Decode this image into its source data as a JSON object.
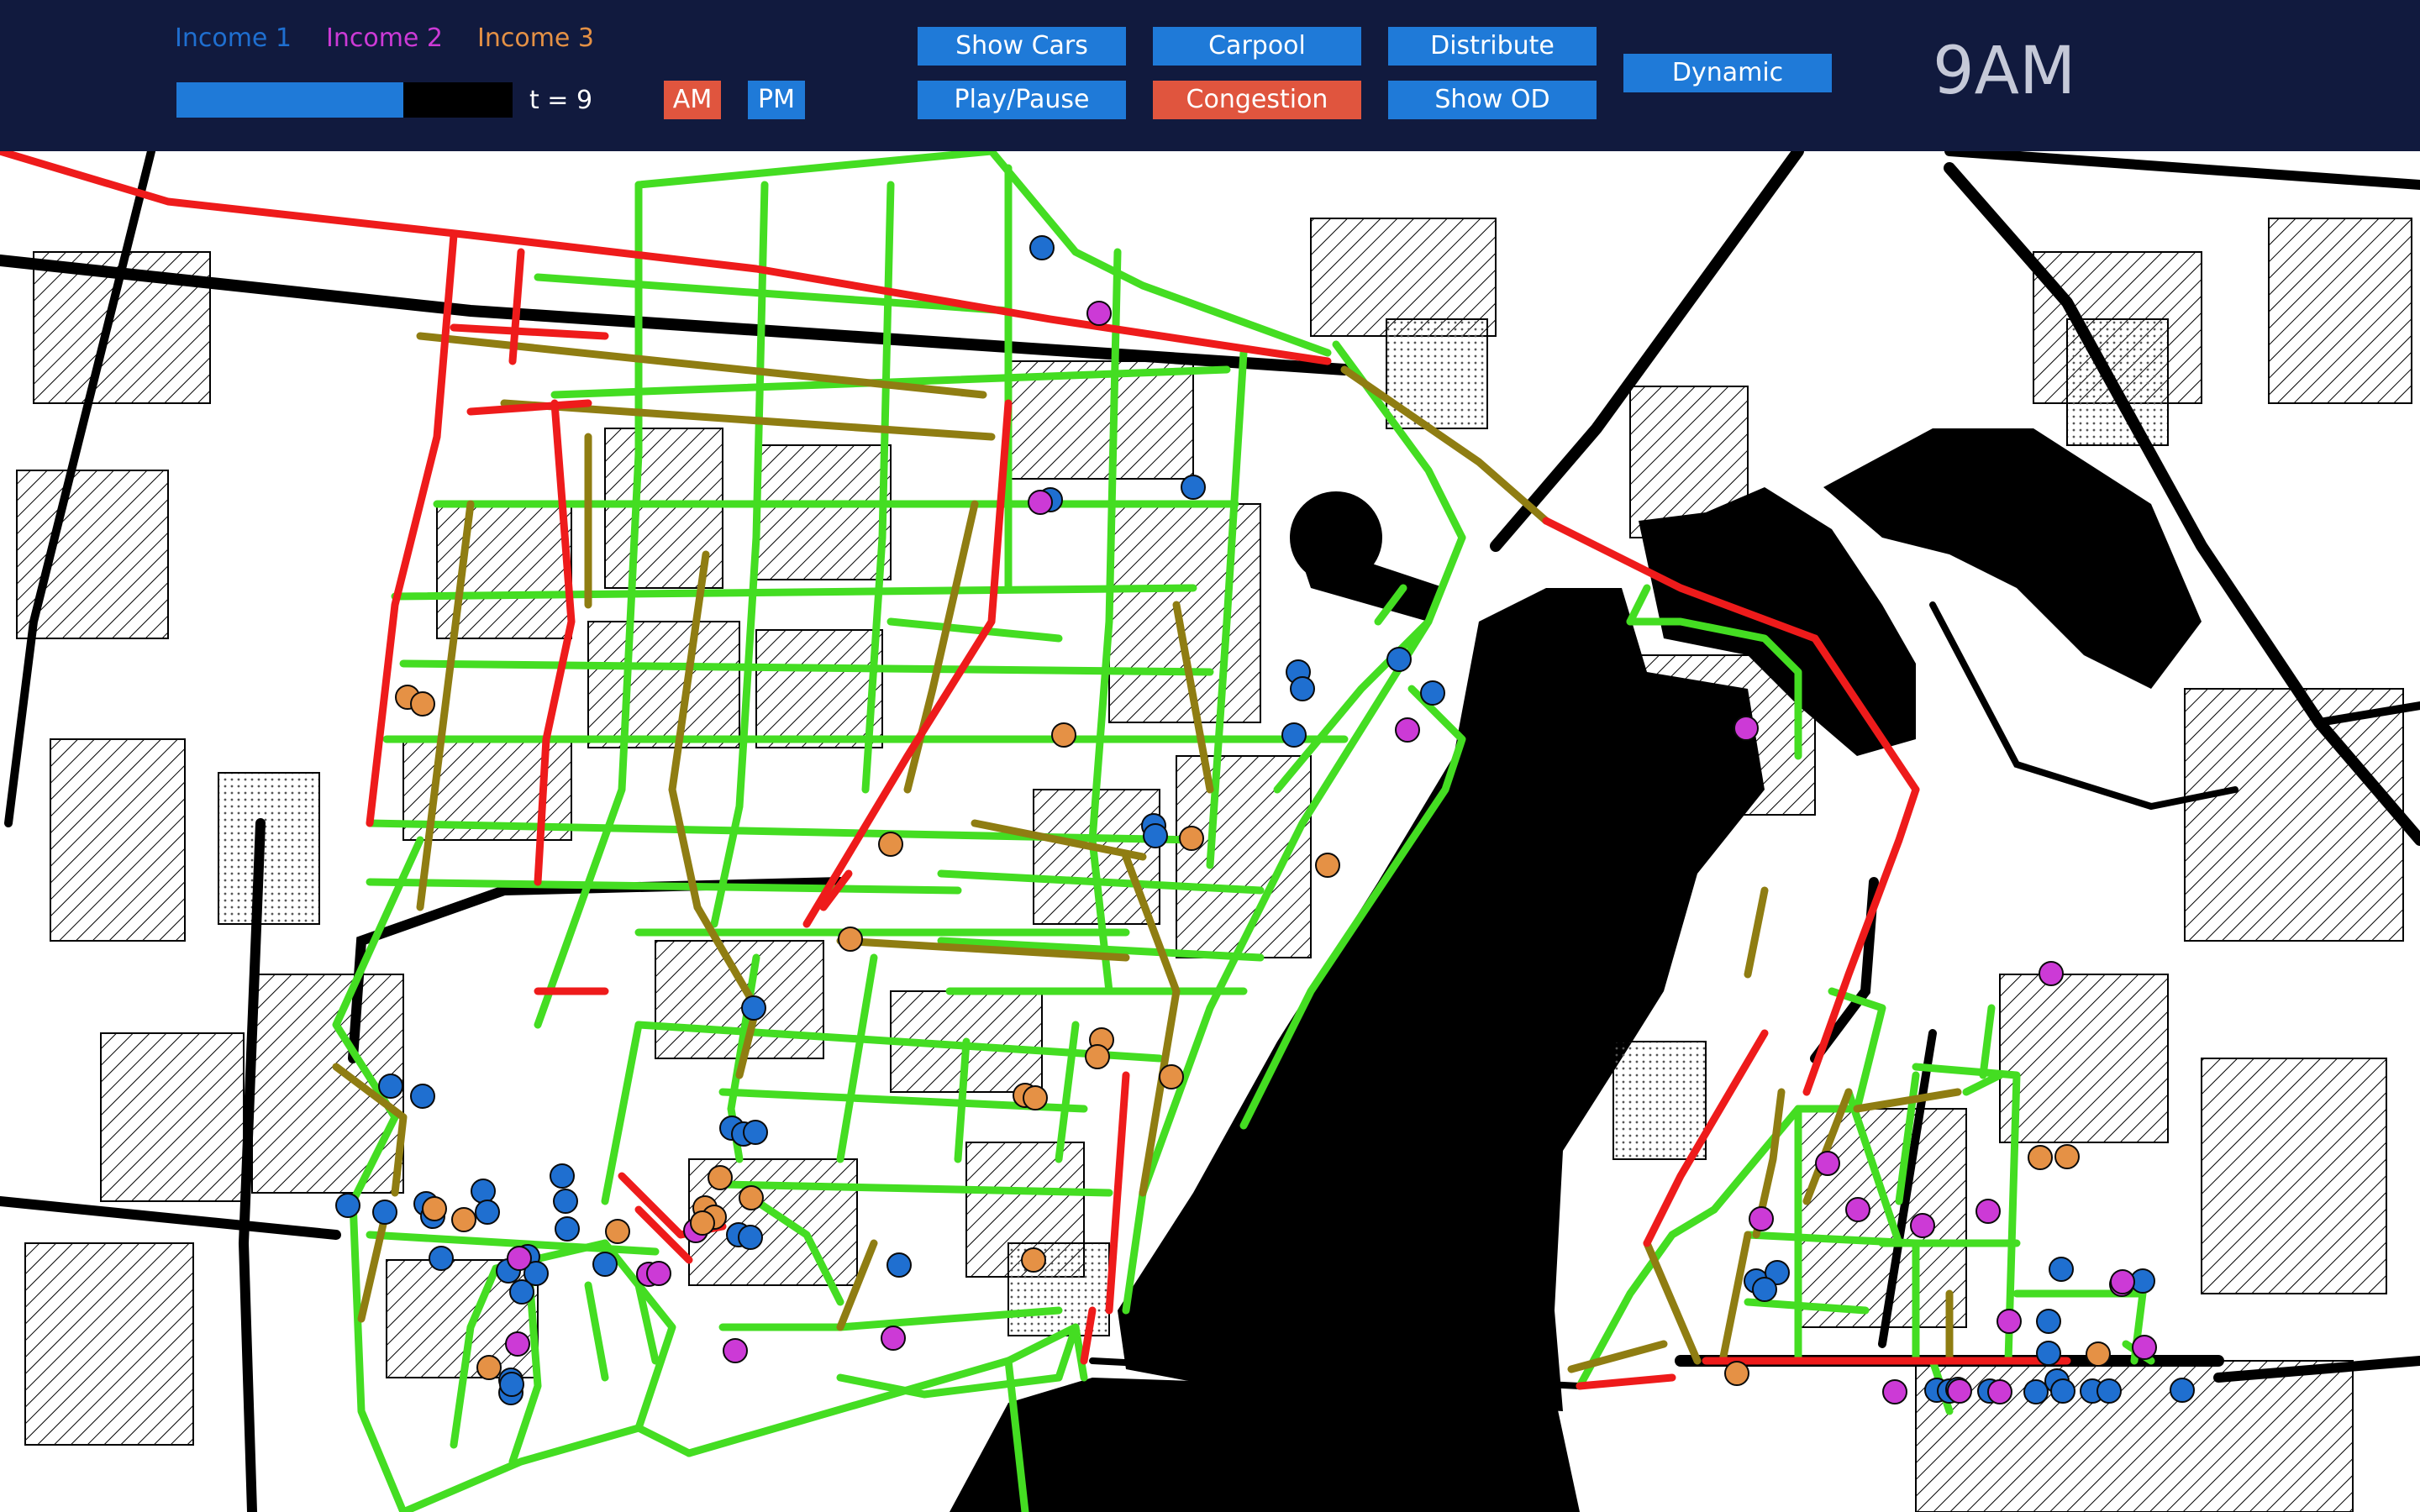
{
  "legend": [
    {
      "label": "Income 1",
      "color": "#1f6fd0"
    },
    {
      "label": "Income 2",
      "color": "#cc3ad6"
    },
    {
      "label": "Income 3",
      "color": "#e59145"
    }
  ],
  "timeline": {
    "progress": 0.675,
    "label": "t = 9"
  },
  "period_buttons": {
    "am": "AM",
    "pm": "PM"
  },
  "buttons": {
    "show_cars": "Show Cars",
    "carpool": "Carpool",
    "distribute": "Distribute",
    "play_pause": "Play/Pause",
    "congestion": "Congestion",
    "show_od": "Show OD",
    "dynamic": "Dynamic"
  },
  "clock": "9AM",
  "colors": {
    "bar_bg": "#111a3e",
    "button_blue": "#1f7ad8",
    "button_red": "#e0553e",
    "road_free": "#44dd22",
    "road_medium": "#8f7d12",
    "road_congested": "#ee1b1b",
    "water": "#000000"
  }
}
